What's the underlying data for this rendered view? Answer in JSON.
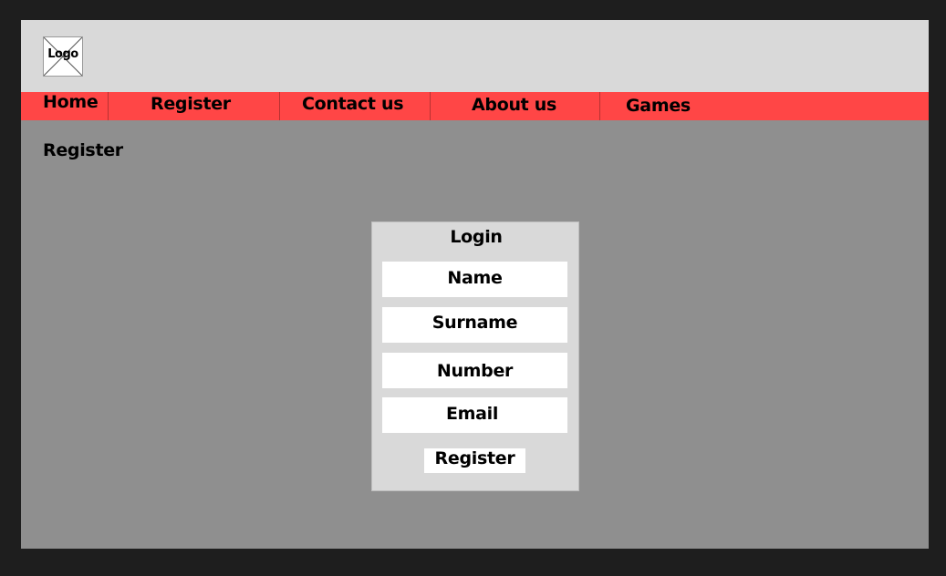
{
  "header": {
    "logo_label": "Logo"
  },
  "nav": {
    "items": [
      {
        "label": "Home"
      },
      {
        "label": "Register"
      },
      {
        "label": "Contact us"
      },
      {
        "label": "About us"
      },
      {
        "label": "Games"
      }
    ]
  },
  "main": {
    "page_title": "Register",
    "form": {
      "title": "Login",
      "fields": [
        {
          "label": "Name"
        },
        {
          "label": "Surname"
        },
        {
          "label": "Number"
        },
        {
          "label": "Email"
        }
      ],
      "submit_label": "Register"
    }
  },
  "colors": {
    "background": "#1e1e1e",
    "content": "#8f8f8f",
    "header": "#d9d9d9",
    "nav": "#ff4646",
    "panel": "#d9d9d9",
    "field": "#ffffff"
  }
}
